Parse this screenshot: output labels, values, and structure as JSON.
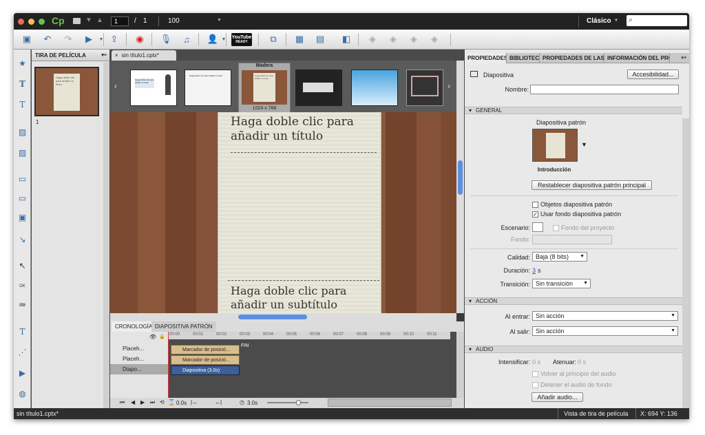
{
  "app": {
    "logo": "Cp",
    "page_current": "1",
    "page_sep": "/",
    "page_total": "1",
    "zoom": "100",
    "workspace": "Clásico",
    "search_icon_text": "⌕"
  },
  "toolbar": {
    "youtube_label": "YouTube",
    "youtube_sub": "READY"
  },
  "filmstrip": {
    "title": "TIRA DE PELÍCULA",
    "slide_number": "1",
    "thumb_text": "Haga doble clic para añadir un título"
  },
  "document": {
    "tab": "sin título1.cptx*",
    "tab_close": "×"
  },
  "themes": {
    "selected_name": "Madera",
    "selected_size": "1024 x 768",
    "thumb_title": "Haga doble clic para añadir un título",
    "thumb_sub": "Haga doble clic para añadir un subtítulo"
  },
  "slide": {
    "title": "Haga doble clic para añadir un título",
    "subtitle": "Haga doble clic para añadir un subtítulo"
  },
  "timeline": {
    "tabs": [
      "CRONOLOGÍA",
      "DIAPOSITIVA PATRÓN"
    ],
    "rows": [
      "Placeh...",
      "Placeh...",
      "Diapo..."
    ],
    "bars": [
      "Marcador de posició...",
      "Marcador de posició...",
      "Diapositiva (3.0s)"
    ],
    "ticks": [
      "00:00",
      "00:01",
      "00:02",
      "00:03",
      "00:04",
      "00:05",
      "00:06",
      "00:07",
      "00:08",
      "00:09",
      "00:10",
      "00:11"
    ],
    "end_label": "FIN",
    "time_current": "0.0s",
    "time_total": "3.0s"
  },
  "properties": {
    "tabs": [
      "PROPIEDADES",
      "BIBLIOTECA",
      "PROPIEDADES DE LAS PR",
      "INFORMACIÓN DEL PROY"
    ],
    "object_type": "Diapositiva",
    "accessibility_button": "Accesibilidad...",
    "name_label": "Nombre:",
    "name_value": "",
    "general": {
      "header": "GENERAL",
      "master_label": "Diapositiva patrón",
      "master_name": "Introducción",
      "reset_button": "Restablecer diapositiva patrón principal",
      "master_objects": "Objetos diapositiva patrón",
      "use_master_bg": "Usar fondo diapositiva patrón",
      "stage_label": "Escenario:",
      "project_bg": "Fondo del proyecto",
      "bg_label": "Fondo:",
      "quality_label": "Calidad:",
      "quality_value": "Baja (8 bits)",
      "duration_label": "Duración:",
      "duration_value": "3",
      "duration_unit": "s",
      "transition_label": "Transición:",
      "transition_value": "Sin transición"
    },
    "action": {
      "header": "ACCIÓN",
      "on_enter_label": "Al entrar:",
      "on_enter_value": "Sin acción",
      "on_exit_label": "Al salir:",
      "on_exit_value": "Sin acción"
    },
    "audio": {
      "header": "AUDIO",
      "fade_in_label": "Intensificar:",
      "fade_in_value": "0 s",
      "fade_out_label": "Atenuar:",
      "fade_out_value": "0 s",
      "loop_audio": "Volver al principio del audio",
      "stop_bg_audio": "Detener el audio de fondo",
      "add_audio_button": "Añadir audio..."
    }
  },
  "status": {
    "file": "sin título1.cptx*",
    "view": "Vista de tira de película",
    "coords": "X: 694 Y: 136"
  },
  "colors": {
    "accent": "#3a6ea5",
    "wood": "#7b4a31",
    "timeline_bar": "#d9bd8c",
    "slide_bar": "#3d5f9a"
  }
}
